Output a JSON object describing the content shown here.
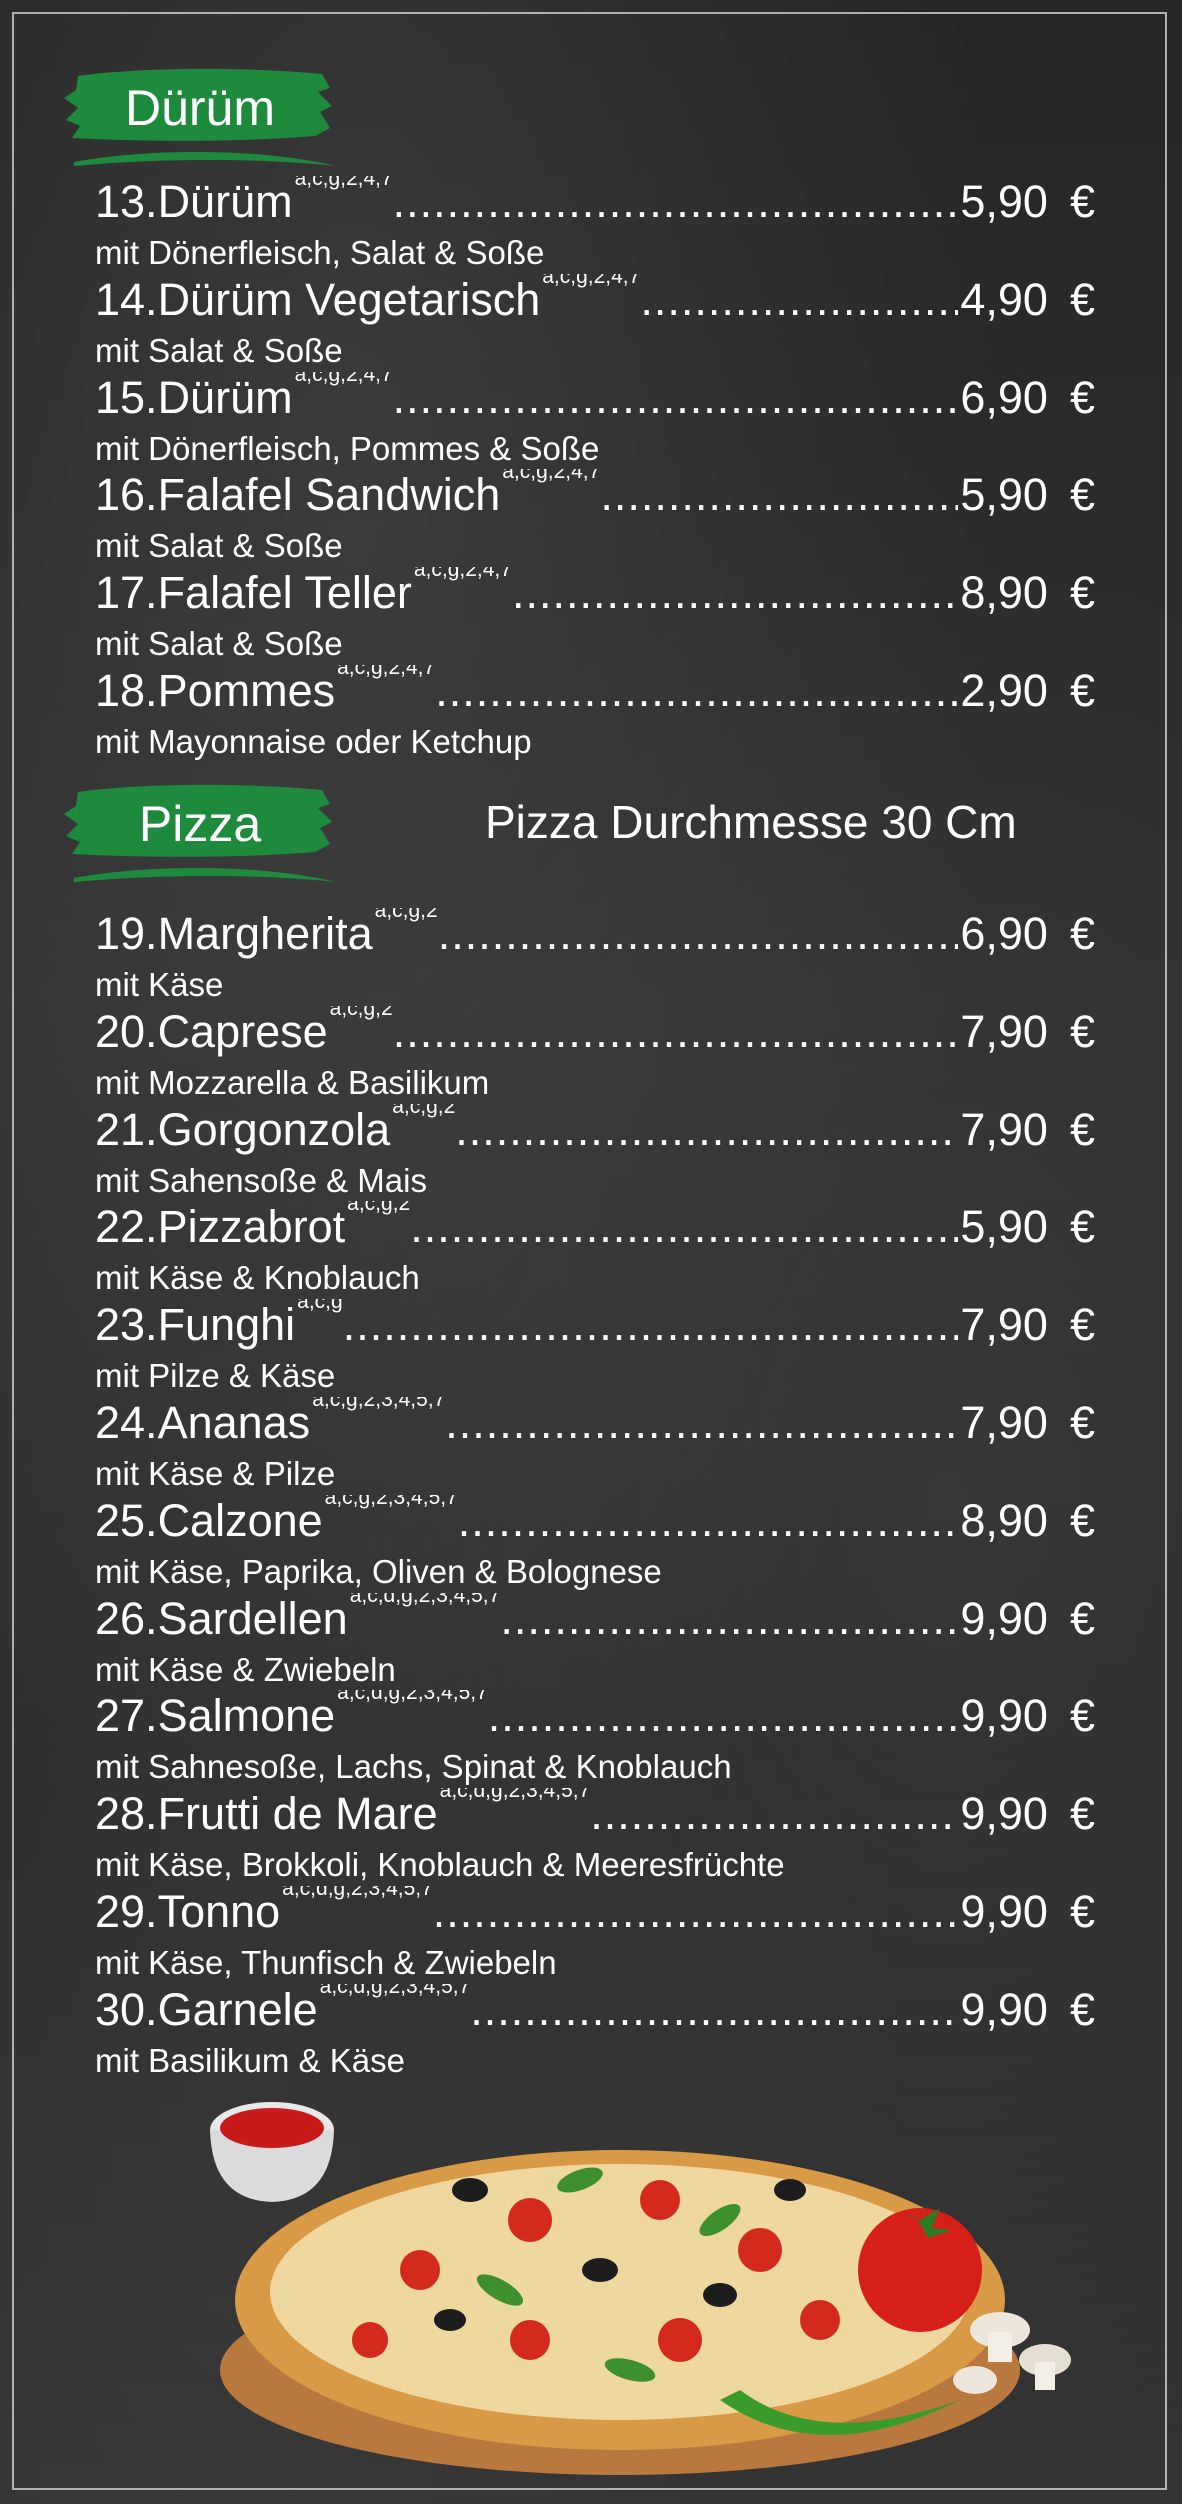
{
  "sections": [
    {
      "title": "Dürüm",
      "items": [
        {
          "num": "13.",
          "name": "Dürüm",
          "allergens": "a,c,g,2,4,7",
          "price": "5,90",
          "currency": "€",
          "desc": "mit Dönerfleisch, Salat & Soße"
        },
        {
          "num": "14.",
          "name": "Dürüm  Vegetarisch",
          "allergens": "a,c,g,2,4,7",
          "price": "4,90",
          "currency": "€",
          "desc": "mit Salat & Soße"
        },
        {
          "num": "15.",
          "name": "Dürüm",
          "allergens": "a,c,g,2,4,7",
          "price": "6,90",
          "currency": "€",
          "desc": "mit Dönerfleisch, Pommes & Soße"
        },
        {
          "num": "16.",
          "name": "Falafel  Sandwich",
          "allergens": "a,c,g,2,4,7",
          "price": "5,90",
          "currency": "€",
          "desc": "mit Salat & Soße"
        },
        {
          "num": "17.",
          "name": "Falafel  Teller",
          "allergens": "a,c,g,2,4,7",
          "price": "8,90",
          "currency": "€",
          "desc": "mit  Salat & Soße"
        },
        {
          "num": "18.",
          "name": "Pommes",
          "allergens": "a,c,g,2,4,7",
          "price": "2,90",
          "currency": "€",
          "desc": "mit Mayonnaise oder Ketchup"
        }
      ]
    },
    {
      "title": "Pizza",
      "subtitle": "Pizza Durchmesse  30 Cm",
      "items": [
        {
          "num": "19.",
          "name": "Margherita",
          "allergens": "a,c,g,2",
          "price": "6,90",
          "currency": "€",
          "desc": "mit Käse"
        },
        {
          "num": "20.",
          "name": "Caprese",
          "allergens": "a,c,g,2",
          "price": "7,90",
          "currency": "€",
          "desc": "mit Mozzarella & Basilikum"
        },
        {
          "num": "21.",
          "name": "Gorgonzola",
          "allergens": "a,c,g,2",
          "price": "7,90",
          "currency": "€",
          "desc": "mit Sahensoße & Mais"
        },
        {
          "num": "22.",
          "name": "Pizzabrot",
          "allergens": "a,c,g,2",
          "price": "5,90",
          "currency": "€",
          "desc": "mit Käse & Knoblauch"
        },
        {
          "num": "23.",
          "name": "Funghi",
          "allergens": "a,c,g",
          "price": "7,90",
          "currency": "€",
          "desc": "mit  Pilze & Käse"
        },
        {
          "num": "24.",
          "name": "Ananas",
          "allergens": "a,c,g,2,3,4,5,7",
          "price": "7,90",
          "currency": "€",
          "desc": "mit Käse & Pilze"
        },
        {
          "num": "25.",
          "name": "Calzone",
          "allergens": "a,c,g,2,3,4,5,7",
          "price": "8,90",
          "currency": "€",
          "desc": "mit Käse, Paprika, Oliven & Bolognese"
        },
        {
          "num": "26.",
          "name": "Sardellen",
          "allergens": "a,c,d,g,2,3,4,5,7",
          "price": "9,90",
          "currency": "€",
          "desc": "mit Käse & Zwiebeln"
        },
        {
          "num": "27.",
          "name": "Salmone",
          "allergens": "a,c,d,g,2,3,4,5,7",
          "price": "9,90",
          "currency": "€",
          "desc": "mit Sahnesoße, Lachs, Spinat & Knoblauch"
        },
        {
          "num": "28.",
          "name": "Frutti  de  Mare",
          "allergens": "a,c,d,g,2,3,4,5,7",
          "price": "9,90",
          "currency": "€",
          "desc": "mit Käse, Brokkoli, Knoblauch & Meeresfrüchte"
        },
        {
          "num": "29.",
          "name": "Tonno",
          "allergens": "a,c,d,g,2,3,4,5,7",
          "price": "9,90",
          "currency": "€",
          "desc": "mit Käse, Thunfisch & Zwiebeln"
        },
        {
          "num": "30.",
          "name": "Garnele",
          "allergens": "a,c,d,g,2,3,4,5,7",
          "price": "9,90",
          "currency": "€",
          "desc": "mit Basilikum & Käse"
        }
      ]
    }
  ],
  "colors": {
    "banner_green": "#1e8a3c",
    "text": "#ffffff",
    "background": "#2b2b2b"
  }
}
